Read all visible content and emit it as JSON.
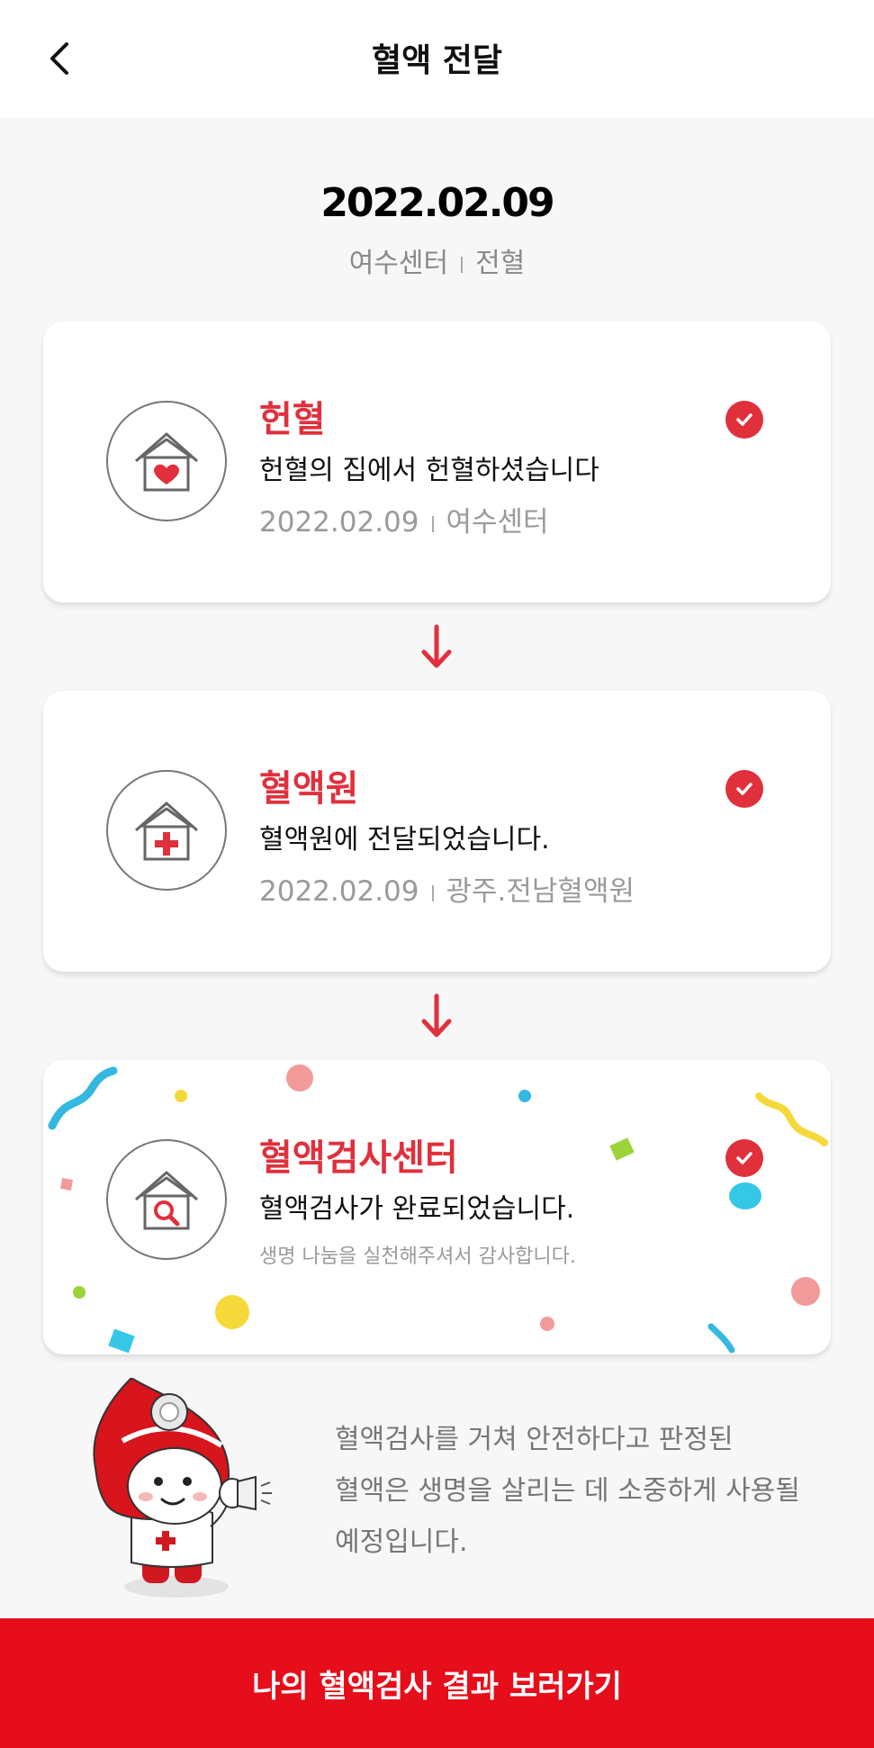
{
  "header": {
    "title": "혈액 전달"
  },
  "summary": {
    "date": "2022.02.09",
    "center": "여수센터",
    "type": "전혈"
  },
  "steps": [
    {
      "title": "헌혈",
      "desc": "헌혈의 집에서 헌혈하셨습니다",
      "date": "2022.02.09",
      "place": "여수센터",
      "icon": "house-heart-icon"
    },
    {
      "title": "혈액원",
      "desc": "혈액원에 전달되었습니다.",
      "date": "2022.02.09",
      "place": "광주.전남혈액원",
      "icon": "house-cross-icon"
    },
    {
      "title": "혈액검사센터",
      "desc": "혈액검사가 완료되었습니다.",
      "note": "생명 나눔을 실천해주셔서 감사합니다.",
      "icon": "house-magnifier-icon"
    }
  ],
  "info": {
    "line1": "혈액검사를 거쳐 안전하다고 판정된",
    "line2": "혈액은 생명을 살리는 데 소중하게 사용될",
    "line3": "예정입니다."
  },
  "cta": {
    "label": "나의 혈액검사 결과 보러가기"
  },
  "colors": {
    "accent": "#e0303c",
    "cta_bg": "#e60e1b"
  }
}
